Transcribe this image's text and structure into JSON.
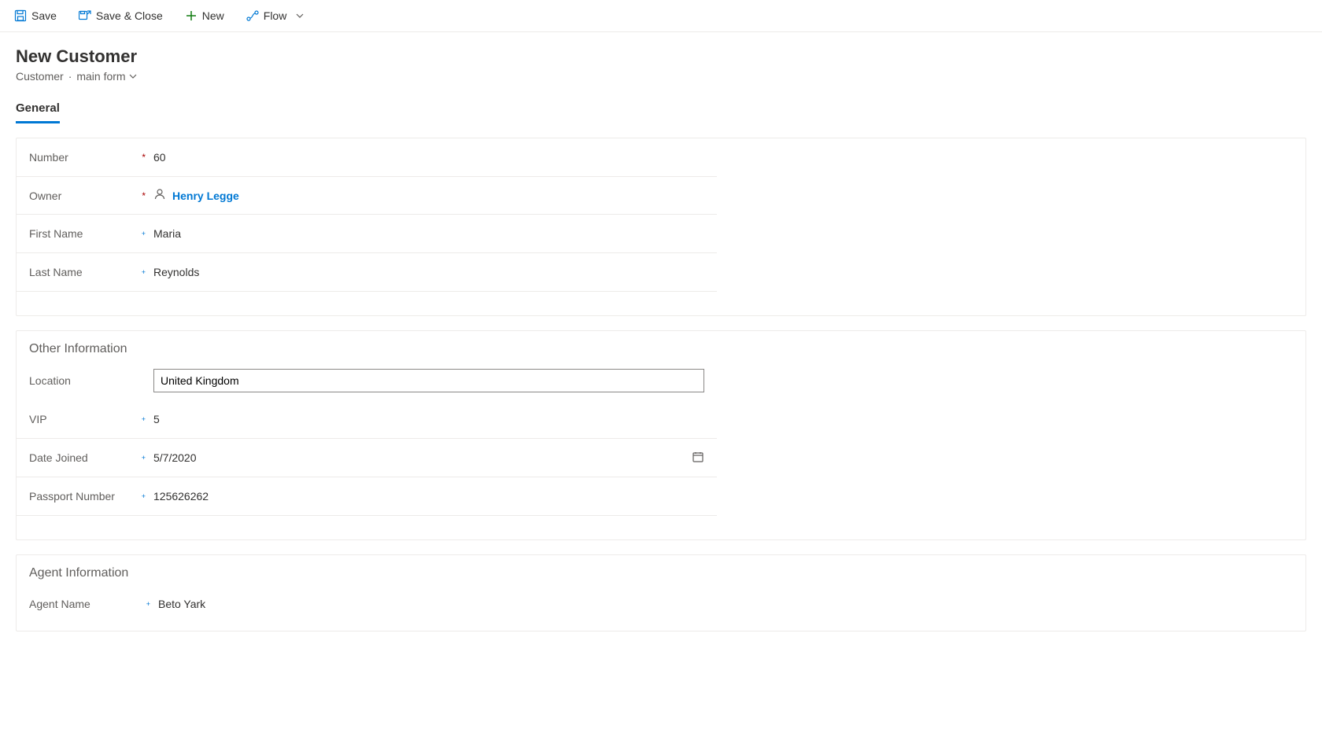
{
  "toolbar": {
    "save": "Save",
    "save_close": "Save & Close",
    "new": "New",
    "flow": "Flow"
  },
  "header": {
    "title": "New Customer",
    "entity": "Customer",
    "separator": "·",
    "form_name": "main form"
  },
  "tabs": {
    "general": "General"
  },
  "sections": {
    "general": {
      "fields": {
        "number": {
          "label": "Number",
          "value": "60"
        },
        "owner": {
          "label": "Owner",
          "value": "Henry Legge"
        },
        "first_name": {
          "label": "First Name",
          "value": "Maria"
        },
        "last_name": {
          "label": "Last Name",
          "value": "Reynolds"
        }
      }
    },
    "other": {
      "title": "Other Information",
      "fields": {
        "location": {
          "label": "Location",
          "value": "United Kingdom"
        },
        "vip": {
          "label": "VIP",
          "value": "5"
        },
        "date_joined": {
          "label": "Date Joined",
          "value": "5/7/2020"
        },
        "passport": {
          "label": "Passport Number",
          "value": "125626262"
        }
      }
    },
    "agent": {
      "title": "Agent Information",
      "fields": {
        "agent_name": {
          "label": "Agent Name",
          "value": "Beto Yark"
        }
      }
    }
  }
}
